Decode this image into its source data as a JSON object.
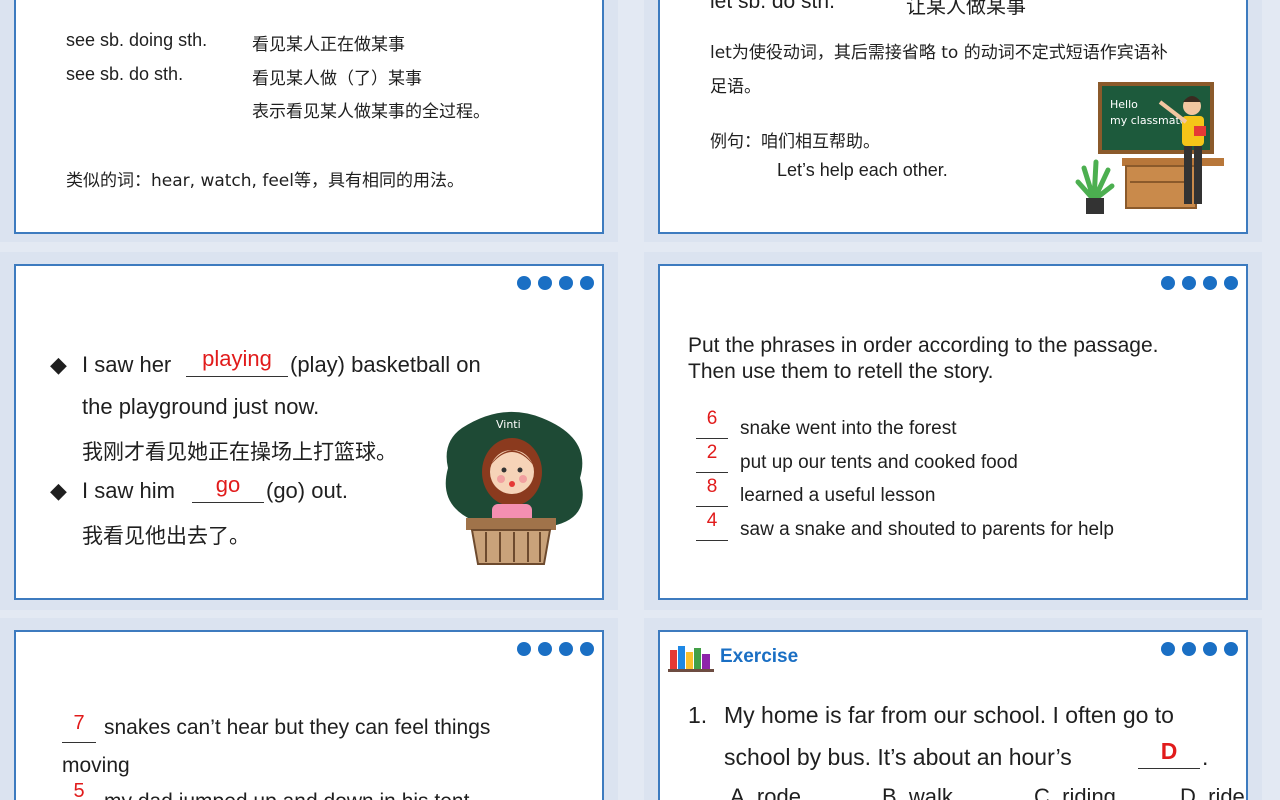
{
  "slide1": {
    "line1_en": "see sb. doing sth.",
    "line1_cn": "看见某人正在做某事",
    "line2_en": "see sb. do sth.",
    "line2_cn": "看见某人做（了）某事",
    "line3_cn": "表示看见某人做某事的全过程。",
    "line4": "类似的词：hear, watch, feel等，具有相同的用法。"
  },
  "slide2": {
    "heading_en": "let sb. do sth.",
    "heading_cn": "让某人做某事",
    "desc_line1": "let为使役动词，其后需接省略 to 的动词不定式短语作宾语补",
    "desc_line2": "足语。",
    "example_label": "例句：咱们相互帮助。",
    "example_en": "Let’s help each other.",
    "board_text1": "Hello",
    "board_text2": "my classmates"
  },
  "slide3": {
    "q1_prefix": "I saw her",
    "q1_answer": "playing",
    "q1_suffix": "(play) basketball on",
    "q1_line2": "the playground just now.",
    "q1_cn": "我刚才看见她正在操场上打篮球。",
    "q2_prefix": "I saw him",
    "q2_answer": "go",
    "q2_suffix": "(go) out.",
    "q2_cn": "我看见他出去了。",
    "illustration_text": "Vinti"
  },
  "slide4": {
    "instruction_line1": "Put the phrases in order according to the passage.",
    "instruction_line2": "Then use them to retell the story.",
    "items": [
      {
        "num": "6",
        "text": "snake went into the forest"
      },
      {
        "num": "2",
        "text": "put up our tents and cooked food"
      },
      {
        "num": "8",
        "text": "learned a useful lesson"
      },
      {
        "num": "4",
        "text": "saw a snake and shouted to parents for help"
      }
    ]
  },
  "slide5": {
    "item1_num": "7",
    "item1_text": "snakes can’t hear but they can feel things",
    "item1_line2": "moving",
    "item2_num": "5",
    "item2_text": "my dad jumped up and down in his tent"
  },
  "slide6": {
    "section_title": "Exercise",
    "q_num": "1.",
    "q_line1": "My home is far from our school. I often go to",
    "q_line2_prefix": "school by bus. It’s about an hour’s",
    "q_answer": "D",
    "q_line2_suffix": ".",
    "options": [
      "A. rode",
      "B. walk",
      "C. riding",
      "D. ride"
    ]
  },
  "colors": {
    "accent": "#1a6fc4",
    "border": "#3d7bbf",
    "answer": "#e11b1b"
  }
}
